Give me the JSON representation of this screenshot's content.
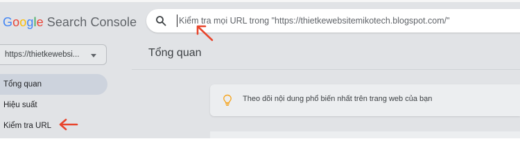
{
  "header": {
    "logo": {
      "letters": [
        "G",
        "o",
        "o",
        "g",
        "l",
        "e"
      ],
      "product": "Search Console"
    },
    "search": {
      "icon": "search-icon",
      "placeholder": "Kiểm tra mọi URL trong \"https://thietkewebsitemikotech.blogspot.com/\""
    }
  },
  "sidebar": {
    "property": {
      "label": "https://thietkewebsi...",
      "icon": "caret-down-icon"
    },
    "items": [
      {
        "label": "Tổng quan",
        "active": true
      },
      {
        "label": "Hiệu suất",
        "active": false
      },
      {
        "label": "Kiểm tra URL",
        "active": false
      }
    ]
  },
  "main": {
    "title": "Tổng quan",
    "tip": {
      "icon": "lightbulb-icon",
      "text": "Theo dõi nội dung phổ biến nhất trên trang web của bạn"
    }
  },
  "colors": {
    "brand_blue": "#4285f4",
    "brand_red": "#ea4335",
    "brand_yellow": "#fbbc05",
    "brand_green": "#34a853",
    "annotation_arrow": "#e8452c",
    "active_nav_bg": "#cdd3dd"
  }
}
